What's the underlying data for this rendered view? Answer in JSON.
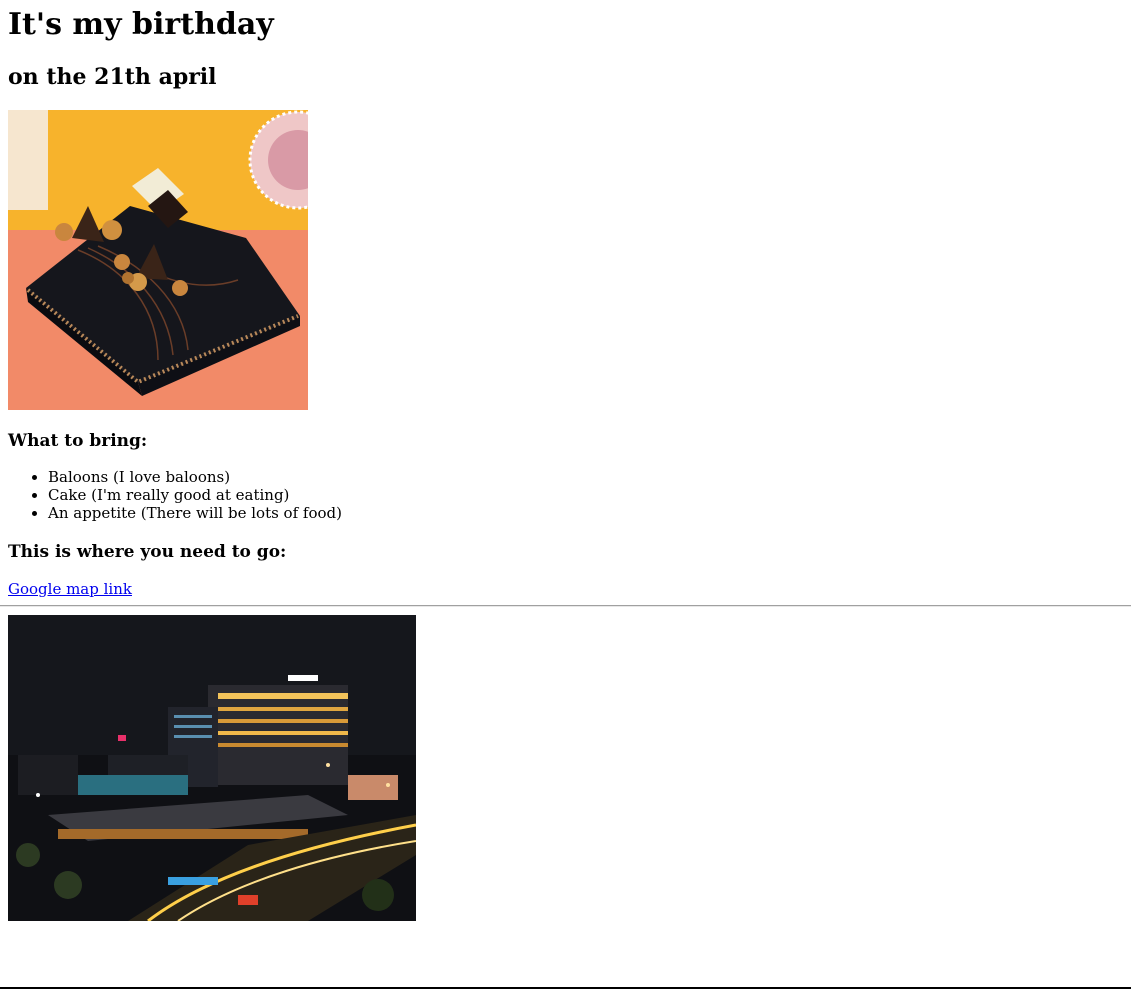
{
  "title": "It's my birthday",
  "date": "on the 21th april",
  "images": {
    "cake_icon": "chocolate-cake-image",
    "city_icon": "night-city-mall-image"
  },
  "bring": {
    "heading": "What to bring:",
    "items": [
      "Baloons (I love baloons)",
      "Cake (I'm really good at eating)",
      "An appetite (There will be lots of food)"
    ]
  },
  "location": {
    "heading": "This is where you need to go:",
    "link_text": "Google map link"
  },
  "colors": {
    "link": "#0000ee",
    "text": "#000000",
    "background": "#ffffff"
  }
}
